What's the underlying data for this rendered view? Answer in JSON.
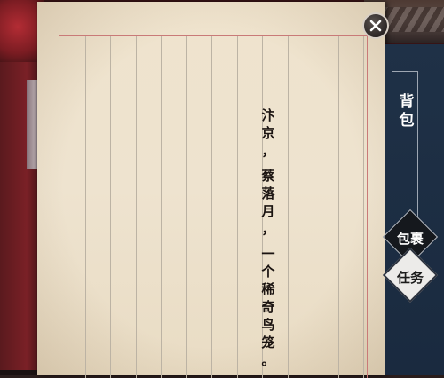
{
  "poem": {
    "characters": [
      "汴",
      "京",
      "，",
      "蔡",
      "落",
      "月",
      "，",
      "一",
      "个",
      "稀",
      "奇",
      "鸟",
      "笼",
      "。"
    ]
  },
  "panel": {
    "bag_title": "背包",
    "tabs": [
      {
        "label": "包裹"
      },
      {
        "label": "任务"
      }
    ]
  },
  "close_icon": "close-icon",
  "colors": {
    "paper": "#eee3cf",
    "frame_border": "#c97a78",
    "panel": "#1f3147"
  }
}
